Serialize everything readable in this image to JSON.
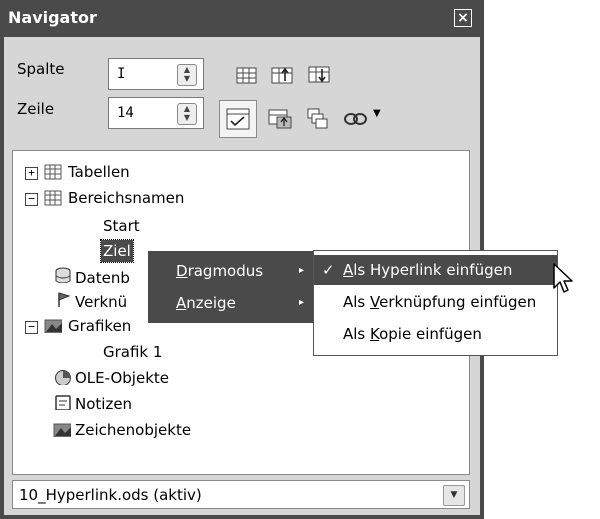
{
  "window": {
    "title": "Navigator"
  },
  "controls": {
    "spalte_label": "Spalte",
    "spalte_value": "I",
    "zeile_label": "Zeile",
    "zeile_value": "14"
  },
  "tree": {
    "items": [
      {
        "label": "Tabellen"
      },
      {
        "label": "Bereichsnamen"
      },
      {
        "label": "Start"
      },
      {
        "label": "Ziel"
      },
      {
        "label": "Datenb"
      },
      {
        "label": "Verknü"
      },
      {
        "label": "Grafiken"
      },
      {
        "label": "Grafik 1"
      },
      {
        "label": "OLE-Objekte"
      },
      {
        "label": "Notizen"
      },
      {
        "label": "Zeichenobjekte"
      }
    ]
  },
  "document_select": {
    "value": "10_Hyperlink.ods (aktiv)"
  },
  "context_menu": {
    "items": [
      {
        "label_ul": "D",
        "label_rest": "ragmodus"
      },
      {
        "label_ul": "A",
        "label_rest": "nzeige"
      }
    ]
  },
  "submenu": {
    "items": [
      {
        "pre": "",
        "ul": "A",
        "post": "ls Hyperlink einfügen",
        "checked": "✓"
      },
      {
        "pre": "Als ",
        "ul": "V",
        "post": "erknüpfung einfügen"
      },
      {
        "pre": "Als ",
        "ul": "K",
        "post": "opie einfügen"
      }
    ]
  },
  "colors": {
    "titlebar": "#4a4a4a",
    "menu_bg": "#4a4a4a",
    "window_bg": "#d6d6d6"
  }
}
